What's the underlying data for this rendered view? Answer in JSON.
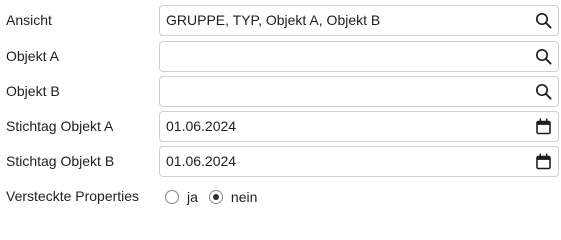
{
  "form": {
    "ansicht": {
      "label": "Ansicht",
      "value": "GRUPPE, TYP, Objekt A, Objekt B",
      "icon": "search-icon"
    },
    "objekt_a": {
      "label": "Objekt A",
      "value": "",
      "icon": "search-icon"
    },
    "objekt_b": {
      "label": "Objekt B",
      "value": "",
      "icon": "search-icon"
    },
    "stichtag_a": {
      "label": "Stichtag Objekt A",
      "value": "01.06.2024",
      "icon": "calendar-icon"
    },
    "stichtag_b": {
      "label": "Stichtag Objekt B",
      "value": "01.06.2024",
      "icon": "calendar-icon"
    },
    "versteckte_properties": {
      "label": "Versteckte Properties",
      "options": [
        {
          "label": "ja",
          "checked": false
        },
        {
          "label": "nein",
          "checked": true
        }
      ]
    }
  }
}
